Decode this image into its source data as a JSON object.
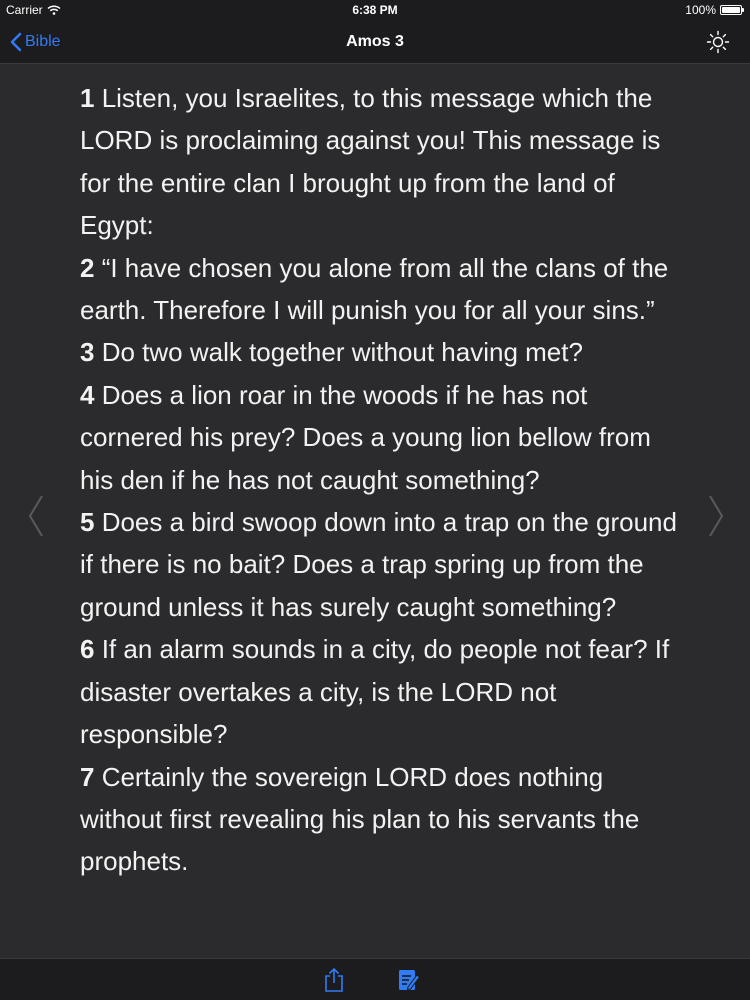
{
  "status_bar": {
    "carrier": "Carrier",
    "time": "6:38 PM",
    "battery": "100%"
  },
  "nav": {
    "back_label": "Bible",
    "title": "Amos 3",
    "accent_color": "#2f7cf6"
  },
  "verses": [
    {
      "num": "1",
      "text": " Listen, you Israelites, to this message which the LORD is proclaiming against you! This message is for the entire clan I brought up from the land of Egypt:"
    },
    {
      "num": "2",
      "text": " “I have chosen you alone from all the clans of the earth. Therefore I will punish you for all your sins.”"
    },
    {
      "num": "3",
      "text": " Do two walk together without having met?"
    },
    {
      "num": "4",
      "text": " Does a lion roar in the woods if he has not cornered his prey? Does a young lion bellow from his den if he has not caught something?"
    },
    {
      "num": "5",
      "text": " Does a bird swoop down into a trap on the ground if there is no bait? Does a trap spring up from the ground unless it has surely caught something?"
    },
    {
      "num": "6",
      "text": " If an alarm sounds in a city, do people not fear? If disaster overtakes a city, is the LORD not responsible?"
    },
    {
      "num": "7",
      "text": " Certainly the sovereign LORD does nothing without first revealing his plan to his servants the prophets."
    }
  ],
  "icons": {
    "back": "chevron-left-icon",
    "brightness": "sun-icon",
    "prev": "chevron-left-icon",
    "next": "chevron-right-icon",
    "share": "share-icon",
    "notes": "note-edit-icon"
  }
}
